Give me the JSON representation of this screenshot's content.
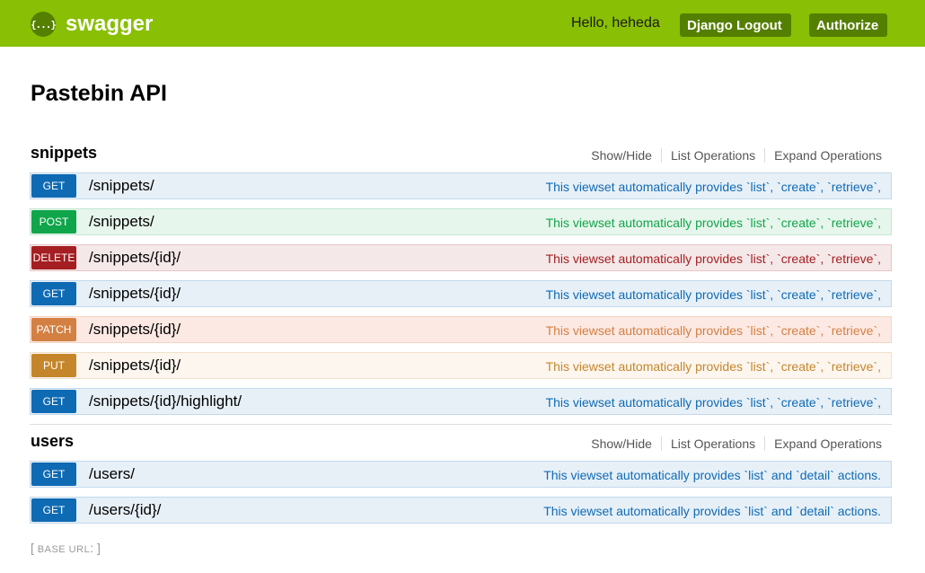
{
  "header": {
    "logo_glyph": "{...}",
    "logo_text": "swagger",
    "greeting": "Hello, heheda",
    "logout_label": "Django Logout",
    "authorize_label": "Authorize",
    "colors": {
      "bar": "#89bf04",
      "button": "#547f00"
    }
  },
  "title": "Pastebin API",
  "resource_links": {
    "show_hide": "Show/Hide",
    "list_ops": "List Operations",
    "expand_ops": "Expand Operations"
  },
  "resources": [
    {
      "name": "snippets",
      "operations": [
        {
          "method": "GET",
          "path": "/snippets/",
          "summary": "This viewset automatically provides `list`, `create`, `retrieve`,"
        },
        {
          "method": "POST",
          "path": "/snippets/",
          "summary": "This viewset automatically provides `list`, `create`, `retrieve`,"
        },
        {
          "method": "DELETE",
          "path": "/snippets/{id}/",
          "summary": "This viewset automatically provides `list`, `create`, `retrieve`,"
        },
        {
          "method": "GET",
          "path": "/snippets/{id}/",
          "summary": "This viewset automatically provides `list`, `create`, `retrieve`,"
        },
        {
          "method": "PATCH",
          "path": "/snippets/{id}/",
          "summary": "This viewset automatically provides `list`, `create`, `retrieve`,"
        },
        {
          "method": "PUT",
          "path": "/snippets/{id}/",
          "summary": "This viewset automatically provides `list`, `create`, `retrieve`,"
        },
        {
          "method": "GET",
          "path": "/snippets/{id}/highlight/",
          "summary": "This viewset automatically provides `list`, `create`, `retrieve`,"
        }
      ]
    },
    {
      "name": "users",
      "operations": [
        {
          "method": "GET",
          "path": "/users/",
          "summary": "This viewset automatically provides `list` and `detail` actions."
        },
        {
          "method": "GET",
          "path": "/users/{id}/",
          "summary": "This viewset automatically provides `list` and `detail` actions."
        }
      ]
    }
  ],
  "footer": {
    "open": "[ ",
    "base_url_label": "BASE URL",
    "close": ": ]"
  },
  "method_colors": {
    "GET": "#0f6ab4",
    "POST": "#10a54a",
    "DELETE": "#a41e22",
    "PATCH": "#d38042",
    "PUT": "#c5862b"
  }
}
